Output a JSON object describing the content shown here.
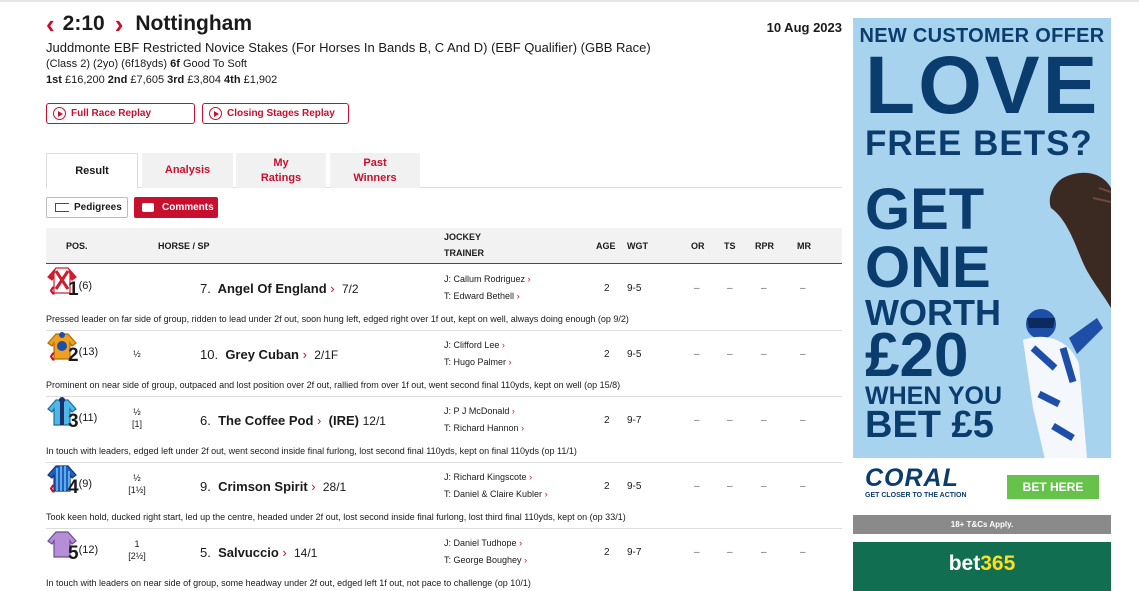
{
  "race": {
    "time": "2:10",
    "course": "Nottingham",
    "date": "10 Aug 2023",
    "title": "Juddmonte EBF Restricted Novice Stakes (For Horses In Bands B, C And D) (EBF Qualifier) (GBB Race)",
    "conditions_prefix": "(Class 2) (2yo) (6f18yds)",
    "distance": "6f",
    "going": "Good To Soft",
    "prizes": [
      {
        "place": "1st",
        "amount": "£16,200"
      },
      {
        "place": "2nd",
        "amount": "£7,605"
      },
      {
        "place": "3rd",
        "amount": "£3,804"
      },
      {
        "place": "4th",
        "amount": "£1,902"
      }
    ]
  },
  "buttons": {
    "full_replay": "Full Race Replay",
    "closing_replay": "Closing Stages Replay",
    "pedigrees": "Pedigrees",
    "comments": "Comments"
  },
  "tabs": [
    {
      "label": "Result",
      "active": true
    },
    {
      "label": "Analysis",
      "active": false
    },
    {
      "label": "My Ratings",
      "active": false
    },
    {
      "label": "Past Winners",
      "active": false
    }
  ],
  "columns": {
    "pos": "POS.",
    "horse": "HORSE / SP",
    "jockey": "JOCKEY",
    "trainer": "TRAINER",
    "age": "AGE",
    "wgt": "WGT",
    "or": "OR",
    "ts": "TS",
    "rpr": "RPR",
    "mr": "MR"
  },
  "runners": [
    {
      "pos": "1",
      "draw": "(6)",
      "chevron": true,
      "dist1": "",
      "dist2": "",
      "number": "7.",
      "horse": "Angel Of England",
      "country": "",
      "sp": "7/2",
      "jockey": "J: Callum Rodriguez",
      "trainer": "T: Edward Bethell",
      "age": "2",
      "wgt": "9-5",
      "or": "–",
      "ts": "–",
      "rpr": "–",
      "mr": "–",
      "comment": "Pressed leader on far side of group, ridden to lead under 2f out, soon hung left, edged right over 1f out, kept on well, always doing enough (op 9/2)",
      "silk": "red-white"
    },
    {
      "pos": "2",
      "draw": "(13)",
      "chevron": true,
      "dist1": "½",
      "dist2": "",
      "number": "10.",
      "horse": "Grey Cuban",
      "country": "",
      "sp": "2/1F",
      "jockey": "J: Clifford Lee",
      "trainer": "T: Hugo Palmer",
      "age": "2",
      "wgt": "9-5",
      "or": "–",
      "ts": "–",
      "rpr": "–",
      "mr": "–",
      "comment": "Prominent on near side of group, outpaced and lost position over 2f out, rallied from over 1f out, went second final 110yds, kept on well (op 15/8)",
      "silk": "orange-blue"
    },
    {
      "pos": "3",
      "draw": "(11)",
      "chevron": false,
      "dist1": "½",
      "dist2": "[1]",
      "number": "6.",
      "horse": "The Coffee Pod",
      "country": "(IRE)",
      "sp": "12/1",
      "jockey": "J: P J McDonald",
      "trainer": "T: Richard Hannon",
      "age": "2",
      "wgt": "9-7",
      "or": "–",
      "ts": "–",
      "rpr": "–",
      "mr": "–",
      "comment": "In touch with leaders, edged left under 2f out, went second inside final furlong, lost second final 110yds, kept on final 110yds (op 11/1)",
      "silk": "lightblue-navy"
    },
    {
      "pos": "4",
      "draw": "(9)",
      "chevron": true,
      "dist1": "½",
      "dist2": "[1½]",
      "number": "9.",
      "horse": "Crimson Spirit",
      "country": "",
      "sp": "28/1",
      "jockey": "J: Richard Kingscote",
      "trainer": "T: Daniel & Claire Kubler",
      "age": "2",
      "wgt": "9-5",
      "or": "–",
      "ts": "–",
      "rpr": "–",
      "mr": "–",
      "comment": "Took keen hold, ducked right start, led up the centre, headed under 2f out, lost second inside final furlong, lost third final 110yds, kept on (op 33/1)",
      "silk": "blue-stripes"
    },
    {
      "pos": "5",
      "draw": "(12)",
      "chevron": false,
      "dist1": "1",
      "dist2": "[2½]",
      "number": "5.",
      "horse": "Salvuccio",
      "country": "",
      "sp": "14/1",
      "jockey": "J: Daniel Tudhope",
      "trainer": "T: George Boughey",
      "age": "2",
      "wgt": "9-7",
      "or": "–",
      "ts": "–",
      "rpr": "–",
      "mr": "–",
      "comment": "In touch with leaders on near side of group, some headway under 2f out, edged left 1f out, not pace to challenge (op 10/1)",
      "silk": "purple"
    }
  ],
  "ad": {
    "line1": "NEW CUSTOMER OFFER",
    "love": "LOVE",
    "free_bets": "FREE BETS?",
    "get": "GET",
    "one": "ONE",
    "worth": "WORTH",
    "amount": "£20",
    "when_you": "WHEN YOU",
    "bet": "BET £5",
    "brand": "CORAL",
    "tagline": "GET CLOSER TO THE ACTION",
    "cta": "BET HERE",
    "terms": "18+ T&Cs Apply."
  },
  "ad2": {
    "brand_a": "bet",
    "brand_b": "365"
  },
  "colors": {
    "accent": "#c8102e",
    "ad_blue": "#0b3c6e",
    "ad_bg": "#a8d3ef",
    "bet365_green": "#126e51"
  }
}
